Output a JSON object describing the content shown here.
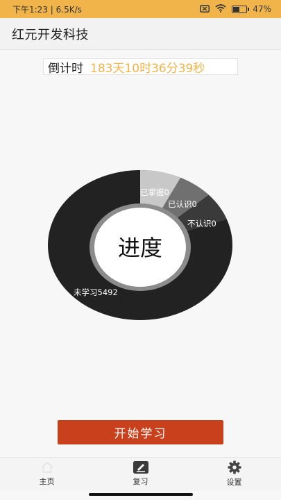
{
  "status_bar": {
    "time_speed": "下午1:23 | 6.5K/s",
    "battery": "47%",
    "battery_level": 0.47
  },
  "app_bar": {
    "title": "红元开发科技"
  },
  "countdown": {
    "label": "倒计时",
    "value": "183天10时36分39秒"
  },
  "chart_data": {
    "type": "pie",
    "center_label": "进度",
    "slices": [
      {
        "label": "已掌握0",
        "value": 0,
        "color": "#c8c8c8"
      },
      {
        "label": "已认识0",
        "value": 0,
        "color": "#707070"
      },
      {
        "label": "不认识0",
        "value": 0,
        "color": "#3a3a3a"
      },
      {
        "label": "未学习5492",
        "value": 5492,
        "color": "#222222"
      }
    ],
    "colors": {
      "mastered": "#c8c8c8",
      "known": "#707070",
      "unknown": "#3a3a3a",
      "unlearned": "#222222"
    }
  },
  "start_button": {
    "label": "开始学习",
    "color": "#c8401c"
  },
  "bottom_nav": {
    "items": [
      {
        "label": "主页",
        "icon": "home-icon"
      },
      {
        "label": "复习",
        "icon": "edit-icon"
      },
      {
        "label": "设置",
        "icon": "gear-icon"
      }
    ]
  }
}
